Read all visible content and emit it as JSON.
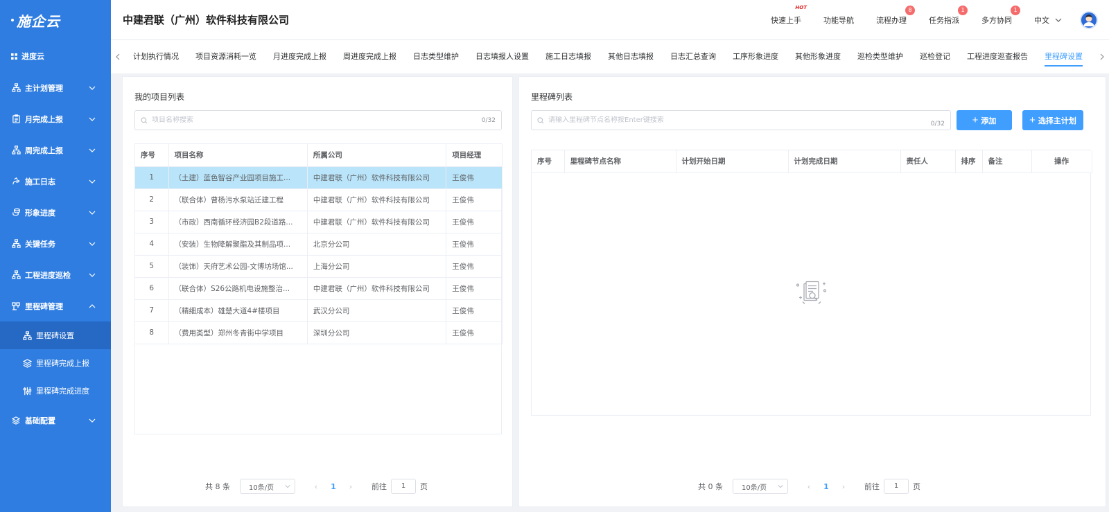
{
  "logo": {
    "text": "施企云"
  },
  "sidebar": {
    "top": {
      "label": "进度云",
      "icon": "grid-icon"
    },
    "items": [
      {
        "label": "主计划管理",
        "icon": "org-chart-icon",
        "expanded": false
      },
      {
        "label": "月完成上报",
        "icon": "clipboard-icon",
        "expanded": false
      },
      {
        "label": "周完成上报",
        "icon": "org-chart-icon",
        "expanded": false
      },
      {
        "label": "施工日志",
        "icon": "hand-icon",
        "expanded": false
      },
      {
        "label": "形象进度",
        "icon": "coins-icon",
        "expanded": false
      },
      {
        "label": "关键任务",
        "icon": "org-chart-icon",
        "expanded": false
      },
      {
        "label": "工程进度巡检",
        "icon": "org-chart-icon",
        "expanded": false
      },
      {
        "label": "里程碑管理",
        "icon": "milestone-icon",
        "expanded": true
      },
      {
        "label": "基础配置",
        "icon": "layers-icon",
        "expanded": false
      }
    ],
    "sub_items": [
      {
        "label": "里程碑设置",
        "icon": "org-chart-icon",
        "active": true
      },
      {
        "label": "里程碑完成上报",
        "icon": "layers-icon",
        "active": false
      },
      {
        "label": "里程碑完成进度",
        "icon": "sliders-icon",
        "active": false
      }
    ]
  },
  "header": {
    "company": "中建君联（广州）软件科技有限公司",
    "nav": [
      {
        "label": "快速上手",
        "hot": "HOT"
      },
      {
        "label": "功能导航"
      },
      {
        "label": "流程办理",
        "badge": "8"
      },
      {
        "label": "任务指派",
        "badge": "1"
      },
      {
        "label": "多方协同",
        "badge": "1"
      }
    ],
    "language": "中文"
  },
  "tabs": [
    "计划执行情况",
    "项目资源消耗一览",
    "月进度完成上报",
    "周进度完成上报",
    "日志类型维护",
    "日志填报人设置",
    "施工日志填报",
    "其他日志填报",
    "日志汇总查询",
    "工序形象进度",
    "其他形象进度",
    "巡检类型维护",
    "巡检登记",
    "工程进度巡查报告",
    "里程碑设置"
  ],
  "active_tab": "里程碑设置",
  "left_panel": {
    "title": "我的项目列表",
    "search": {
      "placeholder": "项目名称搜索",
      "count": "0/32"
    },
    "columns": [
      "序号",
      "项目名称",
      "所属公司",
      "项目经理"
    ],
    "rows": [
      [
        "1",
        "（土建）蓝色智谷产业园项目施工...",
        "中建君联（广州）软件科技有限公司",
        "王俊伟"
      ],
      [
        "2",
        "（联合体）曹杨污水泵站迁建工程",
        "中建君联（广州）软件科技有限公司",
        "王俊伟"
      ],
      [
        "3",
        "（市政）西南循环经济园B2段道路...",
        "中建君联（广州）软件科技有限公司",
        "王俊伟"
      ],
      [
        "4",
        "（安装）生物降解聚酯及其制品项...",
        "北京分公司",
        "王俊伟"
      ],
      [
        "5",
        "（装饰）天府艺术公园-文博坊场馆...",
        "上海分公司",
        "王俊伟"
      ],
      [
        "6",
        "（联合体）S26公路机电设施整治...",
        "中建君联（广州）软件科技有限公司",
        "王俊伟"
      ],
      [
        "7",
        "（精细成本）雄楚大道4#楼项目",
        "武汉分公司",
        "王俊伟"
      ],
      [
        "8",
        "（费用类型）郑州冬青街中学项目",
        "深圳分公司",
        "王俊伟"
      ]
    ],
    "pager": {
      "total": "共 8 条",
      "size": "10条/页",
      "page": "1",
      "goto_label": "前往",
      "goto_value": "1",
      "page_unit": "页"
    }
  },
  "right_panel": {
    "title": "里程碑列表",
    "search": {
      "placeholder": "请输入里程碑节点名称按Enter键搜索",
      "count": "0/32"
    },
    "add_button": "添加",
    "select_plan_button": "选择主计划",
    "columns": [
      "序号",
      "里程碑节点名称",
      "计划开始日期",
      "计划完成日期",
      "责任人",
      "排序",
      "备注",
      "操作"
    ],
    "pager": {
      "total": "共 0 条",
      "size": "10条/页",
      "page": "1",
      "goto_label": "前往",
      "goto_value": "1",
      "page_unit": "页"
    }
  },
  "colors": {
    "sidebar": "#2f7de1",
    "accent": "#409eff",
    "selected_row": "#b9e4f9",
    "badge": "#f56c6c"
  }
}
